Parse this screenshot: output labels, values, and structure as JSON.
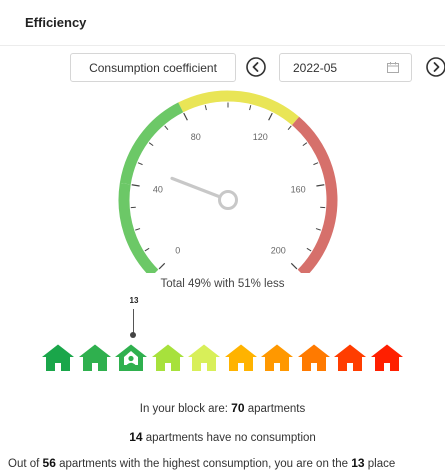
{
  "header": {
    "title": "Efficiency"
  },
  "toolbar": {
    "metric_label": "Consumption coefficient",
    "date_value": "2022-05"
  },
  "gauge": {
    "min": 0,
    "max": 200,
    "value": 49,
    "tick_labels": [
      "0",
      "40",
      "80",
      "120",
      "160",
      "200"
    ],
    "zones": [
      {
        "from": 0,
        "to": 40,
        "color": "#6cc867"
      },
      {
        "from": 40,
        "to": 80,
        "color": "#6cc867"
      },
      {
        "from": 80,
        "to": 130,
        "color": "#e9e556"
      },
      {
        "from": 130,
        "to": 200,
        "color": "#d6706b"
      }
    ],
    "needle_color": "#c8c8c8"
  },
  "summary": {
    "text": "Total 49% with 51% less"
  },
  "ranking": {
    "position_label": "13",
    "highlight_index": 2,
    "house_colors": [
      "#1aa64a",
      "#2fb04e",
      "#2fb04e",
      "#a7e13c",
      "#d8ef59",
      "#ffb300",
      "#ff9800",
      "#ff7a00",
      "#ff3d00",
      "#ff1f00"
    ]
  },
  "stats": {
    "line1_prefix": "In your block are: ",
    "apartments_total": "70",
    "line1_suffix": " apartments",
    "no_consumption_count": "14",
    "line2_suffix": " apartments have no consumption",
    "line3_prefix": "Out of ",
    "highest_count": "56",
    "line3_mid": " apartments with the highest consumption, you are on the ",
    "place": "13",
    "line3_suffix": " place"
  }
}
